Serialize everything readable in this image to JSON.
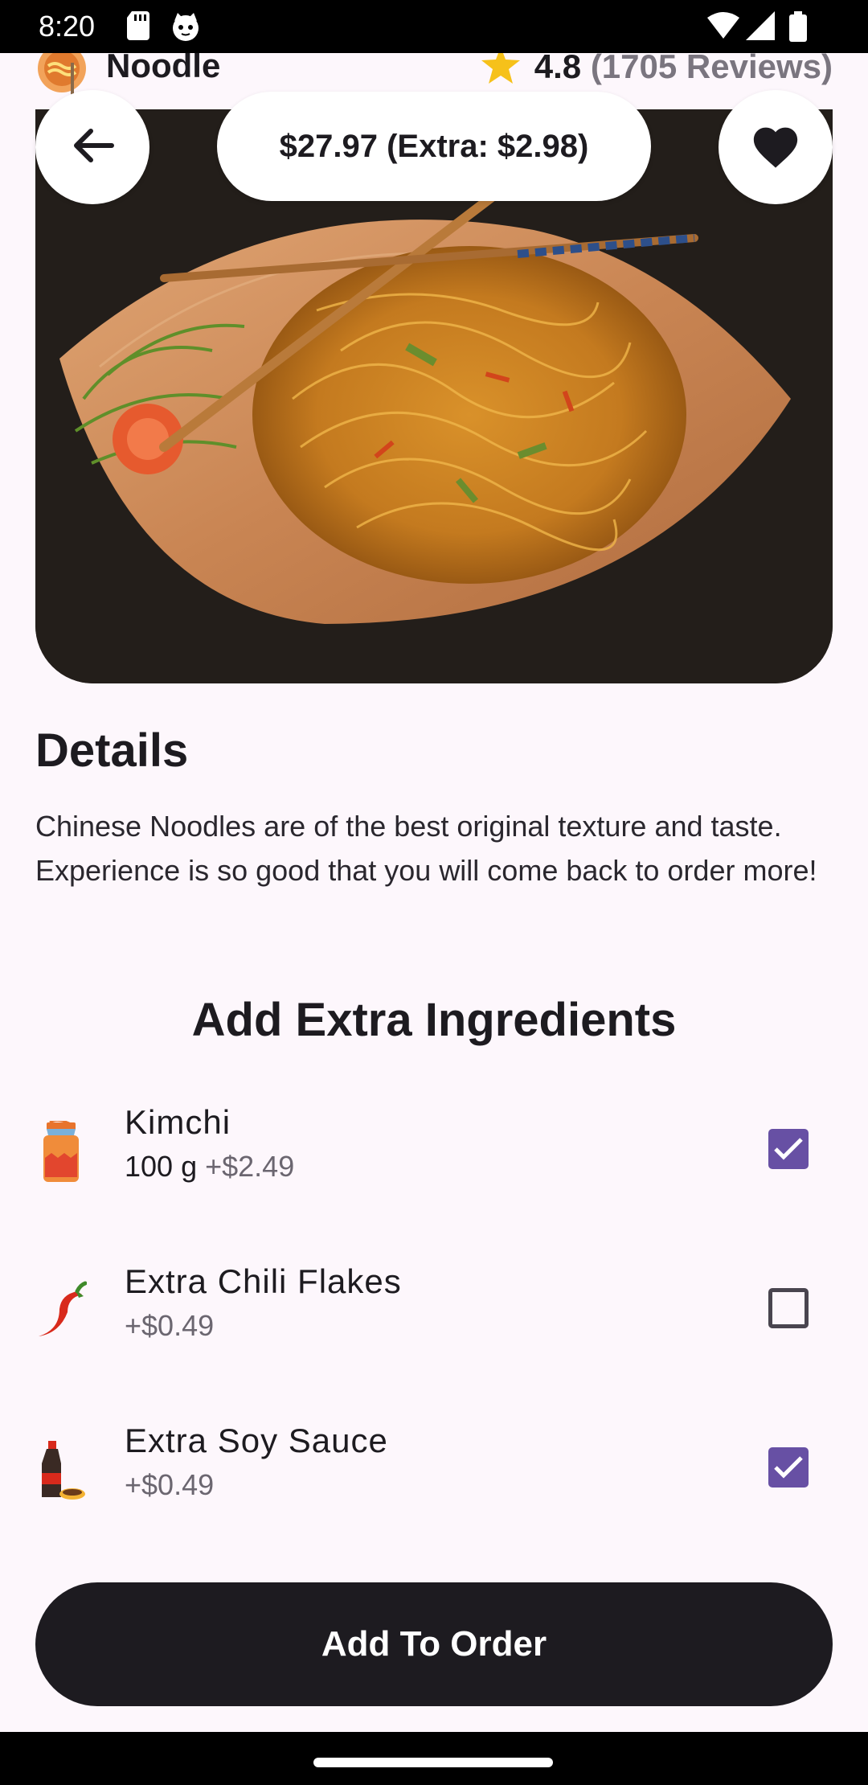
{
  "status_bar": {
    "time": "8:20",
    "icons": [
      "sd-card-icon",
      "cat-icon",
      "wifi-icon",
      "signal-icon",
      "battery-icon"
    ]
  },
  "header": {
    "food_name": "Noodle",
    "food_icon": "noodle-bowl-icon",
    "rating": "4.8",
    "reviews": "(1705 Reviews)",
    "star_color": "#f6c11a"
  },
  "price_pill": {
    "label": "$27.97 (Extra: $2.98)"
  },
  "buttons": {
    "back_icon": "arrow-left-icon",
    "favorite_icon": "heart-icon"
  },
  "details": {
    "title": "Details",
    "text": "Chinese Noodles are of the best original texture and taste. Experience is so good that you will come back to order more!"
  },
  "extras": {
    "title": "Add Extra Ingredients",
    "items": [
      {
        "name": "Kimchi",
        "quantity": "100 g",
        "price": "+$2.49",
        "icon": "kimchi-jar-icon",
        "checked": true
      },
      {
        "name": "Extra Chili Flakes",
        "quantity": "",
        "price": "+$0.49",
        "icon": "chili-pepper-icon",
        "checked": false
      },
      {
        "name": "Extra Soy Sauce",
        "quantity": "",
        "price": "+$0.49",
        "icon": "soy-sauce-icon",
        "checked": true
      }
    ]
  },
  "order_button": {
    "label": "Add To Order"
  },
  "colors": {
    "accent": "#6750a4",
    "background": "#fdf7fc",
    "button_dark": "#1d1b20"
  }
}
